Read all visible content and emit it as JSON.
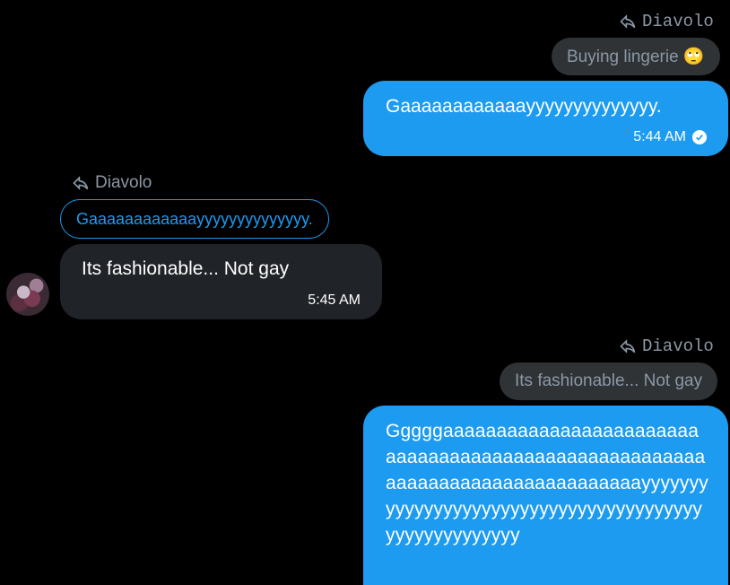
{
  "messages": [
    {
      "reply_to": "Diavolo",
      "quoted": "Buying lingerie 🙄",
      "text": "Gaaaaaaaaaaaayyyyyyyyyyyyyy.",
      "time": "5:44 AM"
    },
    {
      "reply_to": "Diavolo",
      "quoted": "Gaaaaaaaaaaaayyyyyyyyyyyyyy.",
      "text": "Its fashionable... Not gay",
      "time": "5:45 AM"
    },
    {
      "reply_to": "Diavolo",
      "quoted": "Its fashionable... Not gay",
      "text": "Gggggaaaaaaaaaaaaaaaaaaaaaaaaaaaaaaaaaaaaaaaaaaaaaaaaaaaaaaaaaaaaaaaaaaaaaaaaaaaaaayyyyyyyyyyyyyyyyyyyyyyyyyyyyyyyyyyyyyyyyyyyyyyyyyyyyyy"
    }
  ],
  "icons": {
    "reply": "reply-arrow-icon",
    "read": "check-circle-icon"
  },
  "colors": {
    "accent": "#1d9bf0",
    "received_bubble": "#202327",
    "quote_bg": "#2f3336"
  }
}
